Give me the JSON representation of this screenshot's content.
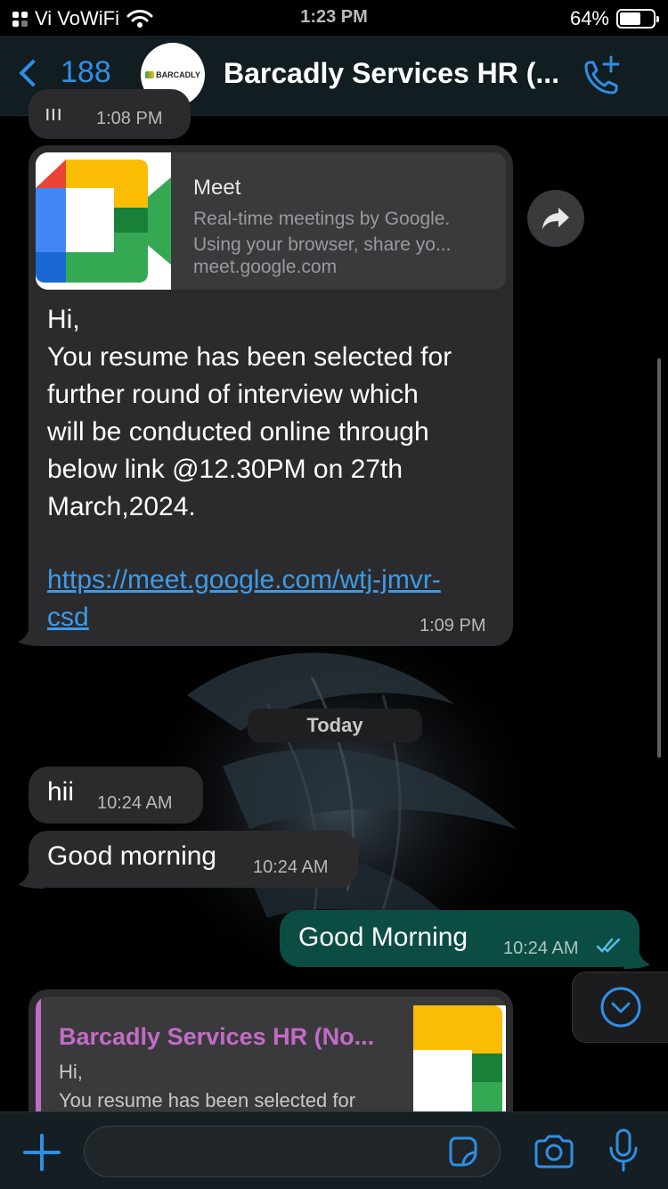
{
  "status_bar": {
    "carrier": "Vi VoWiFi",
    "time": "1:23 PM",
    "battery": "64%",
    "battery_level": 0.64
  },
  "header": {
    "back_count": "188",
    "avatar_logo": "BARCADLY",
    "contact_name": "Barcadly Services HR (..."
  },
  "messages": {
    "previous": {
      "time": "1:08 PM"
    },
    "meet_message": {
      "preview_title": "Meet",
      "preview_desc_line1": "Real-time meetings by Google.",
      "preview_desc_line2": "Using your browser, share yo...",
      "preview_host": "meet.google.com",
      "text_line1": "Hi,",
      "text_line2": "You resume has been selected for",
      "text_line3": "further round of interview which",
      "text_line4": "will be conducted online through",
      "text_line5": "below link @12.30PM on 27th",
      "text_line6": "March,2024.",
      "link_line1": "https://meet.google.com/wtj-jmvr-",
      "link_line2": "csd",
      "time": "1:09 PM"
    },
    "date_separator": "Today",
    "hii": {
      "text": "hii",
      "time": "10:24 AM"
    },
    "good_morning_in": {
      "text": "Good morning",
      "time": "10:24 AM"
    },
    "good_morning_out": {
      "text": "Good Morning",
      "time": "10:24 AM"
    },
    "reply": {
      "name": "Barcadly Services HR (No...",
      "line1": "Hi,",
      "line2": "You resume has been selected for"
    }
  },
  "input": {
    "placeholder": ""
  },
  "colors": {
    "accent": "#2f8fe4",
    "incoming_bubble": "#2b2b2d",
    "outgoing_bubble": "#0b4d43",
    "reply_name": "#c36bc7",
    "link": "#3d9be9"
  },
  "icons": {
    "back": "chevron-left-icon",
    "call": "phone-add-icon",
    "forward": "forward-arrow-icon",
    "scroll": "chevron-down-circle-icon",
    "attach": "plus-icon",
    "sticker": "sticker-icon",
    "camera": "camera-icon",
    "mic": "microphone-icon",
    "read_receipt": "double-check-icon"
  }
}
